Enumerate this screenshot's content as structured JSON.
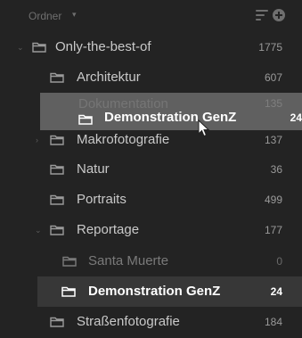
{
  "header": {
    "title": "Ordner",
    "title_chevron": "▾",
    "sort_icon": "sort-icon",
    "add_icon": "add-circle-icon"
  },
  "tree": {
    "root": {
      "label": "Only-the-best-of",
      "count": "1775",
      "chevron": "⌄"
    },
    "items": [
      {
        "label": "Architektur",
        "count": "607"
      },
      {
        "label": "Dokumentation",
        "count": "135"
      },
      {
        "label": "Makrofotografie",
        "count": "137",
        "chevron": "›"
      },
      {
        "label": "Natur",
        "count": "36"
      },
      {
        "label": "Portraits",
        "count": "499"
      },
      {
        "label": "Reportage",
        "count": "177",
        "chevron": "⌄"
      },
      {
        "label": "Santa Muerte",
        "count": "0"
      },
      {
        "label": "Demonstration GenZ",
        "count": "24"
      },
      {
        "label": "Straßenfotografie",
        "count": "184"
      }
    ]
  },
  "drag": {
    "label": "Demonstration GenZ",
    "count": "24"
  },
  "colors": {
    "background": "#232323",
    "selected_row": "#373737",
    "drop_highlight": "#6b6b6b",
    "icon": "#8a8a8a"
  }
}
